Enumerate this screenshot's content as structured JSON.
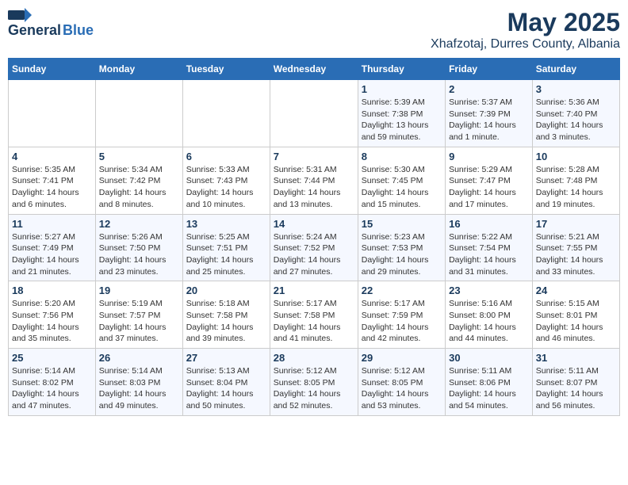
{
  "logo": {
    "general": "General",
    "blue": "Blue"
  },
  "title": "May 2025",
  "location": "Xhafzotaj, Durres County, Albania",
  "days_of_week": [
    "Sunday",
    "Monday",
    "Tuesday",
    "Wednesday",
    "Thursday",
    "Friday",
    "Saturday"
  ],
  "weeks": [
    [
      {
        "num": "",
        "info": ""
      },
      {
        "num": "",
        "info": ""
      },
      {
        "num": "",
        "info": ""
      },
      {
        "num": "",
        "info": ""
      },
      {
        "num": "1",
        "info": "Sunrise: 5:39 AM\nSunset: 7:38 PM\nDaylight: 13 hours and 59 minutes."
      },
      {
        "num": "2",
        "info": "Sunrise: 5:37 AM\nSunset: 7:39 PM\nDaylight: 14 hours and 1 minute."
      },
      {
        "num": "3",
        "info": "Sunrise: 5:36 AM\nSunset: 7:40 PM\nDaylight: 14 hours and 3 minutes."
      }
    ],
    [
      {
        "num": "4",
        "info": "Sunrise: 5:35 AM\nSunset: 7:41 PM\nDaylight: 14 hours and 6 minutes."
      },
      {
        "num": "5",
        "info": "Sunrise: 5:34 AM\nSunset: 7:42 PM\nDaylight: 14 hours and 8 minutes."
      },
      {
        "num": "6",
        "info": "Sunrise: 5:33 AM\nSunset: 7:43 PM\nDaylight: 14 hours and 10 minutes."
      },
      {
        "num": "7",
        "info": "Sunrise: 5:31 AM\nSunset: 7:44 PM\nDaylight: 14 hours and 13 minutes."
      },
      {
        "num": "8",
        "info": "Sunrise: 5:30 AM\nSunset: 7:45 PM\nDaylight: 14 hours and 15 minutes."
      },
      {
        "num": "9",
        "info": "Sunrise: 5:29 AM\nSunset: 7:47 PM\nDaylight: 14 hours and 17 minutes."
      },
      {
        "num": "10",
        "info": "Sunrise: 5:28 AM\nSunset: 7:48 PM\nDaylight: 14 hours and 19 minutes."
      }
    ],
    [
      {
        "num": "11",
        "info": "Sunrise: 5:27 AM\nSunset: 7:49 PM\nDaylight: 14 hours and 21 minutes."
      },
      {
        "num": "12",
        "info": "Sunrise: 5:26 AM\nSunset: 7:50 PM\nDaylight: 14 hours and 23 minutes."
      },
      {
        "num": "13",
        "info": "Sunrise: 5:25 AM\nSunset: 7:51 PM\nDaylight: 14 hours and 25 minutes."
      },
      {
        "num": "14",
        "info": "Sunrise: 5:24 AM\nSunset: 7:52 PM\nDaylight: 14 hours and 27 minutes."
      },
      {
        "num": "15",
        "info": "Sunrise: 5:23 AM\nSunset: 7:53 PM\nDaylight: 14 hours and 29 minutes."
      },
      {
        "num": "16",
        "info": "Sunrise: 5:22 AM\nSunset: 7:54 PM\nDaylight: 14 hours and 31 minutes."
      },
      {
        "num": "17",
        "info": "Sunrise: 5:21 AM\nSunset: 7:55 PM\nDaylight: 14 hours and 33 minutes."
      }
    ],
    [
      {
        "num": "18",
        "info": "Sunrise: 5:20 AM\nSunset: 7:56 PM\nDaylight: 14 hours and 35 minutes."
      },
      {
        "num": "19",
        "info": "Sunrise: 5:19 AM\nSunset: 7:57 PM\nDaylight: 14 hours and 37 minutes."
      },
      {
        "num": "20",
        "info": "Sunrise: 5:18 AM\nSunset: 7:58 PM\nDaylight: 14 hours and 39 minutes."
      },
      {
        "num": "21",
        "info": "Sunrise: 5:17 AM\nSunset: 7:58 PM\nDaylight: 14 hours and 41 minutes."
      },
      {
        "num": "22",
        "info": "Sunrise: 5:17 AM\nSunset: 7:59 PM\nDaylight: 14 hours and 42 minutes."
      },
      {
        "num": "23",
        "info": "Sunrise: 5:16 AM\nSunset: 8:00 PM\nDaylight: 14 hours and 44 minutes."
      },
      {
        "num": "24",
        "info": "Sunrise: 5:15 AM\nSunset: 8:01 PM\nDaylight: 14 hours and 46 minutes."
      }
    ],
    [
      {
        "num": "25",
        "info": "Sunrise: 5:14 AM\nSunset: 8:02 PM\nDaylight: 14 hours and 47 minutes."
      },
      {
        "num": "26",
        "info": "Sunrise: 5:14 AM\nSunset: 8:03 PM\nDaylight: 14 hours and 49 minutes."
      },
      {
        "num": "27",
        "info": "Sunrise: 5:13 AM\nSunset: 8:04 PM\nDaylight: 14 hours and 50 minutes."
      },
      {
        "num": "28",
        "info": "Sunrise: 5:12 AM\nSunset: 8:05 PM\nDaylight: 14 hours and 52 minutes."
      },
      {
        "num": "29",
        "info": "Sunrise: 5:12 AM\nSunset: 8:05 PM\nDaylight: 14 hours and 53 minutes."
      },
      {
        "num": "30",
        "info": "Sunrise: 5:11 AM\nSunset: 8:06 PM\nDaylight: 14 hours and 54 minutes."
      },
      {
        "num": "31",
        "info": "Sunrise: 5:11 AM\nSunset: 8:07 PM\nDaylight: 14 hours and 56 minutes."
      }
    ]
  ]
}
